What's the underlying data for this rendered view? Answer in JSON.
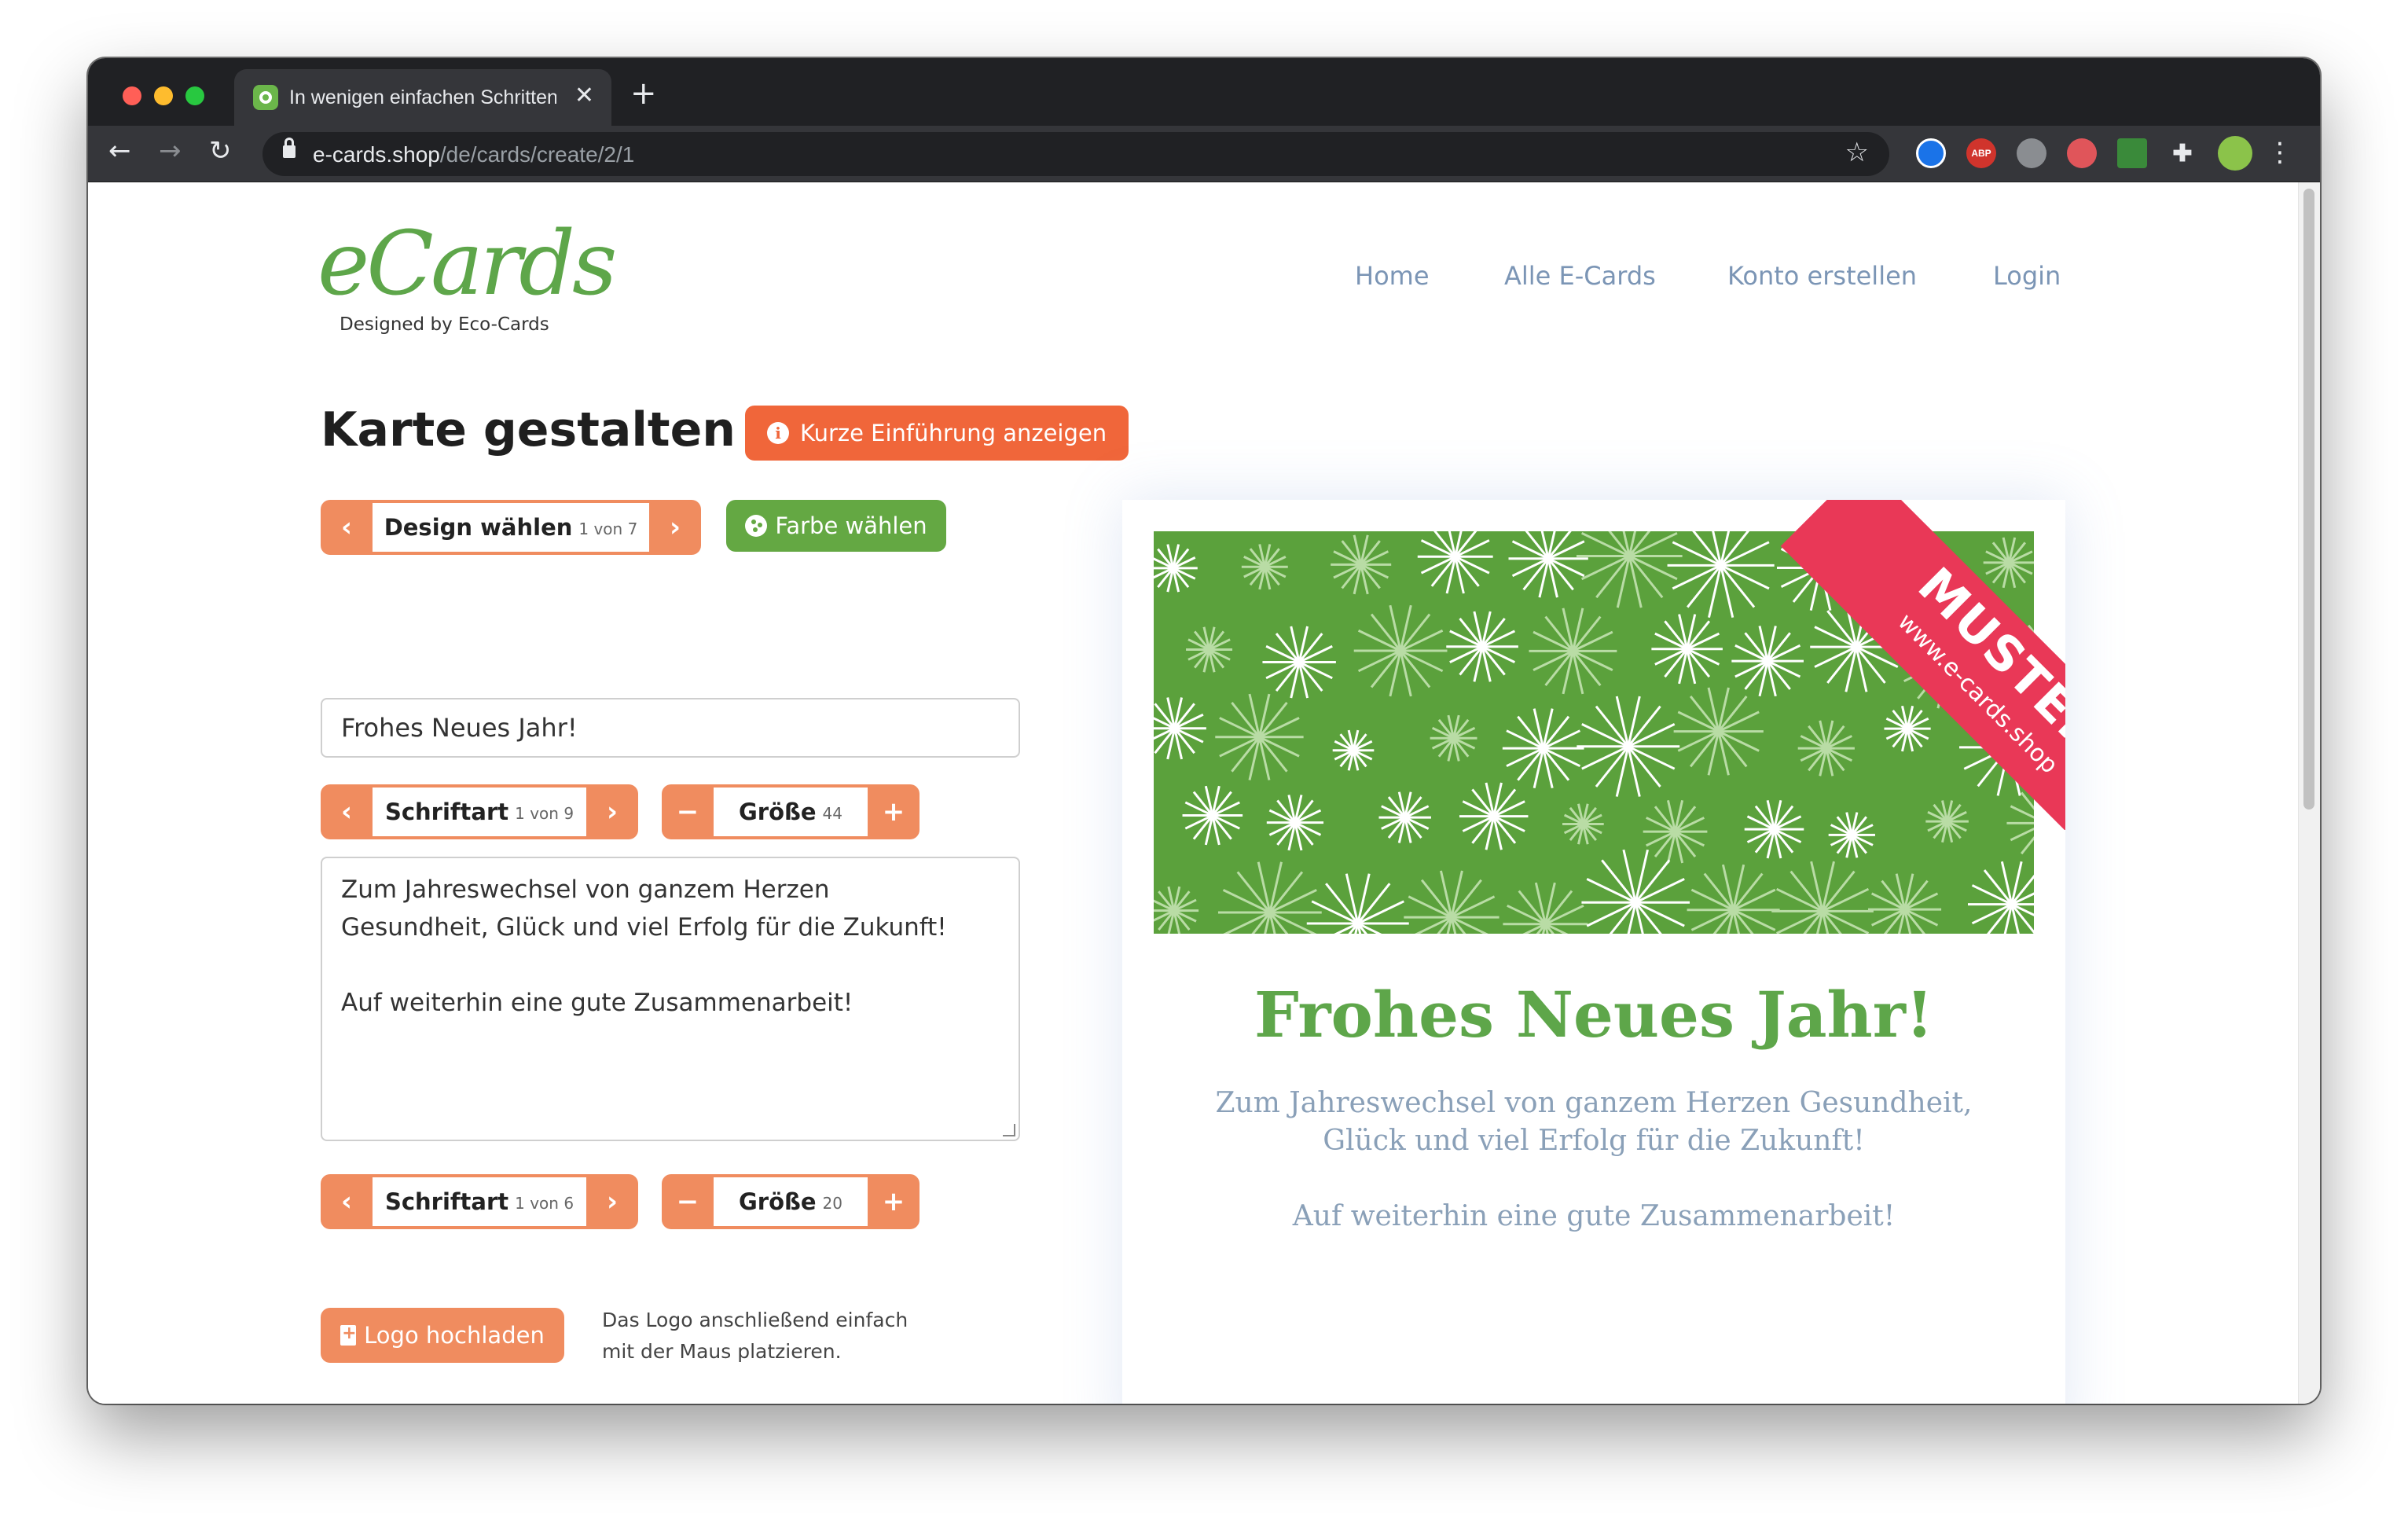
{
  "browser": {
    "tab_title": "In wenigen einfachen Schritten",
    "url_host": "e-cards.shop",
    "url_path": "/de/cards/create/2/1"
  },
  "site": {
    "logo_text": "eCards",
    "logo_tagline": "Designed by Eco-Cards",
    "nav": [
      "Home",
      "Alle E-Cards",
      "Konto erstellen",
      "Login"
    ]
  },
  "editor": {
    "heading": "Karte gestalten",
    "intro_button": "Kurze Einführung anzeigen",
    "design_label": "Design wählen",
    "design_count": "1 von 7",
    "color_button": "Farbe wählen",
    "title_value": "Frohes Neues Jahr!",
    "title_font_label": "Schriftart",
    "title_font_count": "1 von 9",
    "title_size_label": "Größe",
    "title_size_value": "44",
    "body_lines": [
      "Zum Jahreswechsel von ganzem Herzen",
      "Gesundheit, Glück und viel Erfolg für die Zukunft!",
      "",
      "Auf weiterhin eine gute Zusammenarbeit!"
    ],
    "body_font_label": "Schriftart",
    "body_font_count": "1 von 6",
    "body_size_label": "Größe",
    "body_size_value": "20",
    "upload_button": "Logo hochladen",
    "upload_hint_1": "Das Logo anschließend einfach",
    "upload_hint_2": "mit der Maus platzieren."
  },
  "preview": {
    "ribbon_main": "MUSTER",
    "ribbon_sub": "www.e-cards.shop",
    "title": "Frohes Neues Jahr!",
    "body_1": "Zum Jahreswechsel von ganzem Herzen Gesundheit,",
    "body_2": "Glück und viel Erfolg für die Zukunft!",
    "body_3": "Auf weiterhin eine gute Zusammenarbeit!"
  },
  "colors": {
    "accent_orange": "#f08c5f",
    "brand_green": "#5ea64a",
    "ribbon_red": "#e93857"
  }
}
